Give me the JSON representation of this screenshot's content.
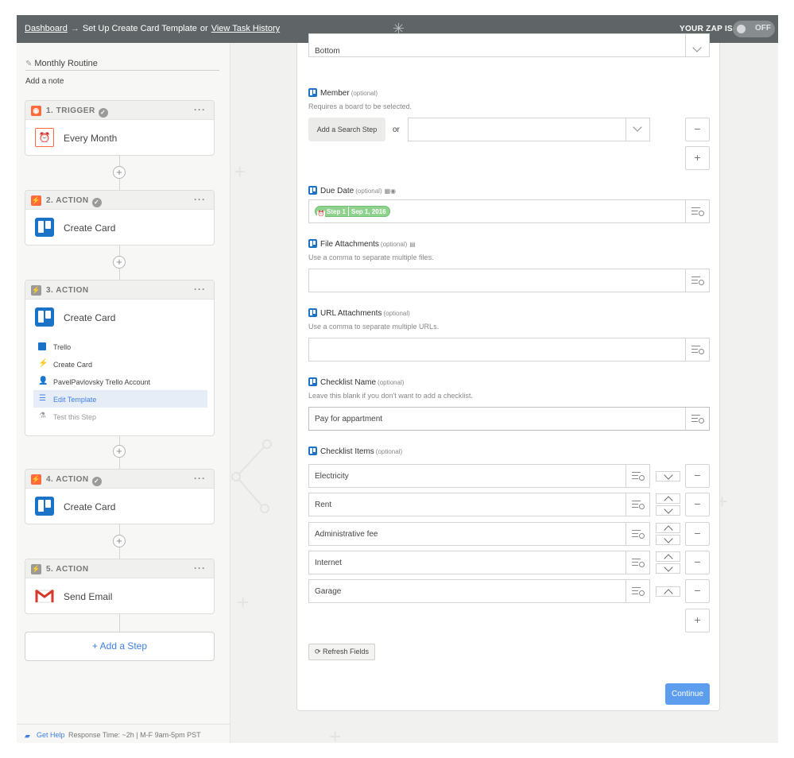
{
  "topbar": {
    "dashboard": "Dashboard",
    "arrow": "→",
    "current": "Set Up Create Card Template",
    "or": "or",
    "history": "View Task History",
    "zap_label": "YOUR ZAP IS",
    "toggle": "OFF"
  },
  "sidebar": {
    "zap_name": "Monthly Routine",
    "add_note": "Add a note",
    "steps": [
      {
        "header": "1. TRIGGER",
        "name": "Every Month",
        "color": "#ff6a3d"
      },
      {
        "header": "2. ACTION",
        "name": "Create Card",
        "color": "#ff6a3d"
      },
      {
        "header": "3. ACTION",
        "name": "Create Card",
        "color": "#9a9a9a"
      },
      {
        "header": "4. ACTION",
        "name": "Create Card",
        "color": "#ff6a3d"
      },
      {
        "header": "5. ACTION",
        "name": "Send Email",
        "color": "#9a9a9a"
      }
    ],
    "sub_items": [
      "Trello",
      "Create Card",
      "PavelPavlovsky Trello Account",
      "Edit Template",
      "Test this Step"
    ],
    "dots": "···",
    "plus": "+",
    "add_step": "+ Add a Step",
    "help": {
      "label": "Get Help",
      "response": "Response Time: ~2h | M-F 9am-5pm PST"
    }
  },
  "form": {
    "position_value": "Bottom",
    "member": {
      "label": "Member",
      "optional": "(optional)",
      "help": "Requires a board to be selected.",
      "search_step": "Add a Search Step",
      "or": "or"
    },
    "due_date": {
      "label": "Due Date",
      "optional": "(optional)",
      "pill_step": "Step 1",
      "pill_value": "Sep 1, 2016"
    },
    "file_attachments": {
      "label": "File Attachments",
      "optional": "(optional)",
      "help": "Use a comma to separate multiple files."
    },
    "url_attachments": {
      "label": "URL Attachments",
      "optional": "(optional)",
      "help": "Use a comma to separate multiple URLs."
    },
    "checklist_name": {
      "label": "Checklist Name",
      "optional": "(optional)",
      "help": "Leave this blank if you don't want to add a checklist.",
      "value": "Pay for appartment"
    },
    "checklist_items": {
      "label": "Checklist Items",
      "optional": "(optional)",
      "items": [
        "Electricity",
        "Rent",
        "Administrative fee",
        "Internet",
        "Garage"
      ]
    },
    "minus": "−",
    "plus": "+",
    "refresh": "Refresh Fields",
    "continue": "Continue"
  },
  "colors": {
    "accent": "#3f81e4",
    "trello": "#1a73c7",
    "trigger": "#ff6a3d",
    "button": "#5c9ded",
    "pill": "#8fd28e"
  }
}
